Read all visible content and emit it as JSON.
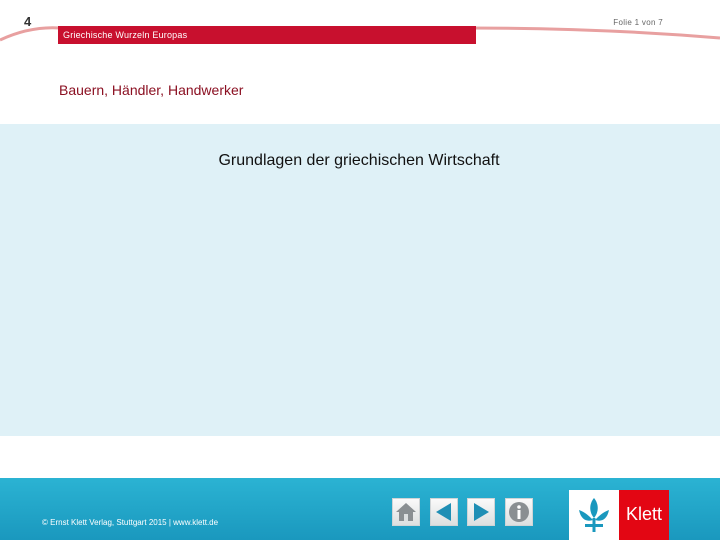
{
  "header": {
    "chapter_number": "4",
    "series_title": "Griechische Wurzeln Europas",
    "slide_counter": "Folie 1 von 7"
  },
  "slide": {
    "subtitle": "Bauern, Händler, Handwerker",
    "heading": "Grundlagen der griechischen Wirtschaft"
  },
  "footer": {
    "copyright": "© Ernst Klett Verlag, Stuttgart 2015 | www.klett.de",
    "nav_buttons": [
      "home-icon",
      "arrow-left-icon",
      "arrow-right-icon",
      "info-icon"
    ],
    "logo_text": "Klett"
  },
  "colors": {
    "accent_red": "#c8102e",
    "content_bg": "#dff1f7",
    "footer_blue": "#1a98be",
    "klett_red": "#e30613"
  }
}
